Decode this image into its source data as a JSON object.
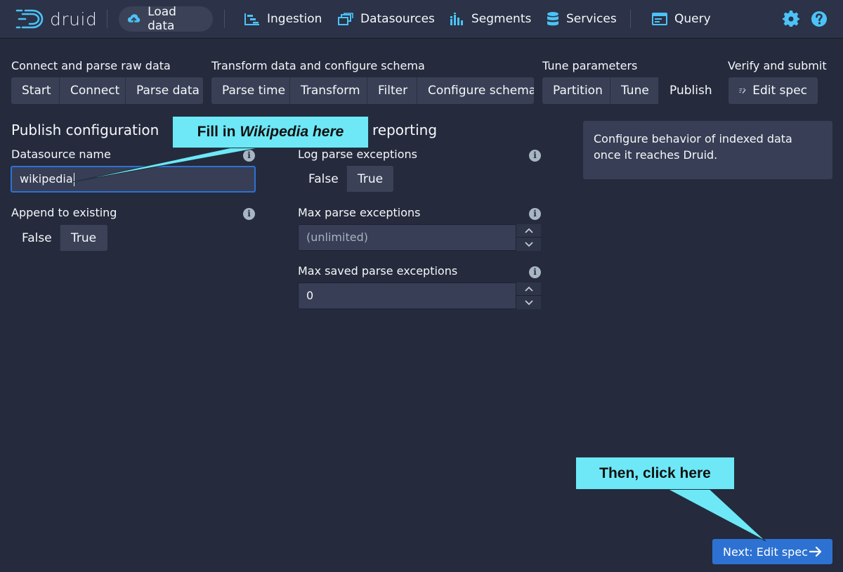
{
  "navbar": {
    "logo_text": "druid",
    "items": [
      {
        "label": "Load data",
        "icon": "cloud-upload-icon"
      },
      {
        "label": "Ingestion",
        "icon": "gantt-chart-icon"
      },
      {
        "label": "Datasources",
        "icon": "multi-select-icon"
      },
      {
        "label": "Segments",
        "icon": "stacked-chart-icon"
      },
      {
        "label": "Services",
        "icon": "database-icon"
      },
      {
        "label": "Query",
        "icon": "application-icon"
      }
    ],
    "settings_icon": "gear-icon",
    "help_icon": "help-icon",
    "accent_color": "#4bc3f7"
  },
  "steps": {
    "groups": [
      {
        "label": "Connect and parse raw data",
        "steps": [
          "Start",
          "Connect",
          "Parse data"
        ]
      },
      {
        "label": "Transform data and configure schema",
        "steps": [
          "Parse time",
          "Transform",
          "Filter",
          "Configure schema"
        ]
      },
      {
        "label": "Tune parameters",
        "steps": [
          "Partition",
          "Tune",
          "Publish"
        ]
      },
      {
        "label": "Verify and submit",
        "steps": [
          "Edit spec"
        ]
      }
    ],
    "active_step": "Publish"
  },
  "publish": {
    "title": "Publish configuration",
    "datasource_label": "Datasource name",
    "datasource_value": "wikipedia",
    "append_label": "Append to existing",
    "append_options": [
      "False",
      "True"
    ],
    "append_selected": "False"
  },
  "errors": {
    "title_visible": "reporting",
    "log_label": "Log parse exceptions",
    "log_options": [
      "False",
      "True"
    ],
    "log_selected": "False",
    "max_label": "Max parse exceptions",
    "max_placeholder": "(unlimited)",
    "max_saved_label": "Max saved parse exceptions",
    "max_saved_value": "0"
  },
  "info_panel": {
    "text": "Configure behavior of indexed data once it reaches Druid."
  },
  "next_button": {
    "label": "Next: Edit spec"
  },
  "callouts": {
    "fill_prefix": "Fill in ",
    "fill_emph": "Wikipedia here",
    "click": "Then, click here",
    "color": "#6ee8f7"
  },
  "colors": {
    "background": "#252a3d",
    "navbar": "#2c3247",
    "primary": "#2d72d2"
  }
}
